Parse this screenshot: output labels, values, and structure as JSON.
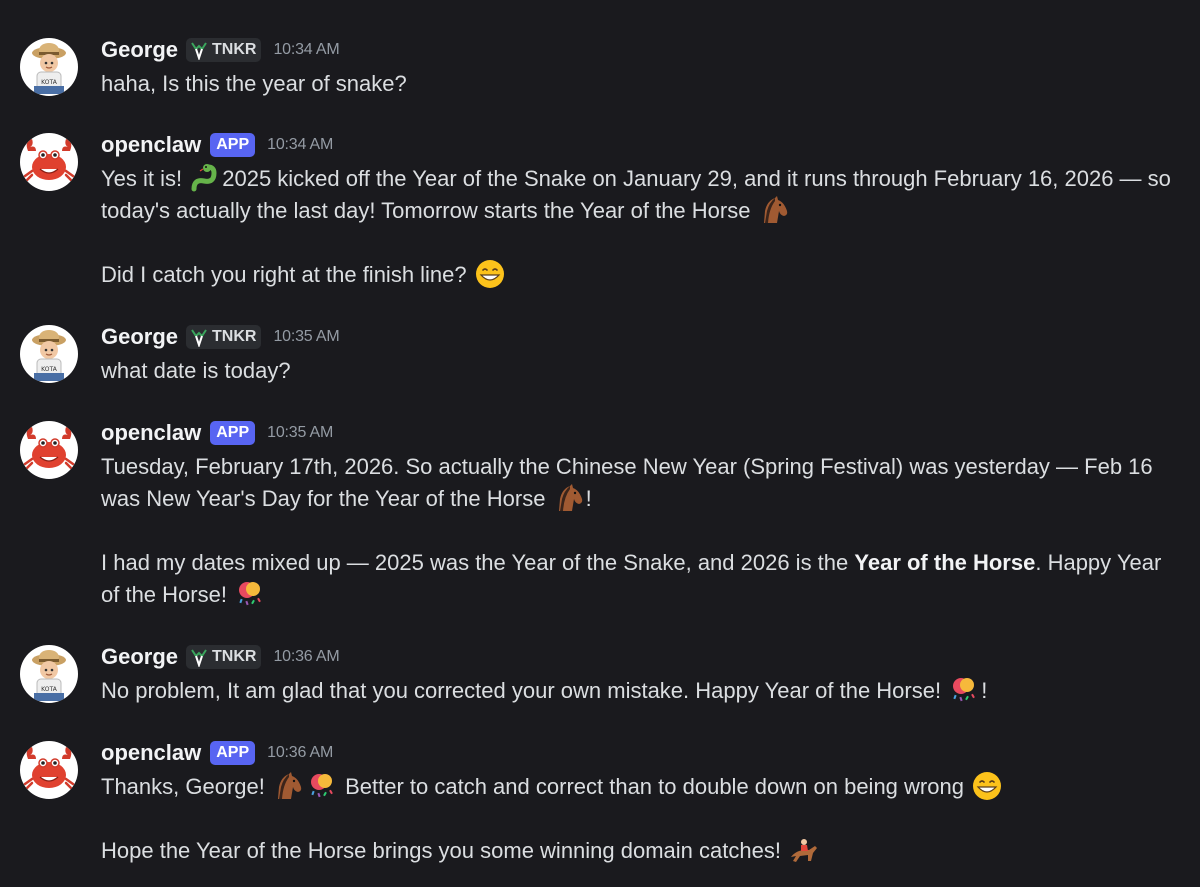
{
  "colors": {
    "background": "#1a1a1e",
    "text": "#dbdee1",
    "username": "#f2f3f5",
    "timestamp": "#949ba4",
    "app_badge": "#5865f2",
    "tag_badge": "#2b2d31"
  },
  "messages": [
    {
      "author": "George",
      "tag": "TNKR",
      "avatar_icon": "boy-avatar-icon",
      "time": "10:34 AM",
      "line1": "haha, Is this the year of snake?"
    },
    {
      "author": "openclaw",
      "tag": "APP",
      "avatar_icon": "crab-avatar-icon",
      "time": "10:34 AM",
      "p1a": "Yes it is! ",
      "p1b": "2025 kicked off the Year of the Snake on January 29, and it runs through February 16, 2026 — so today's actually the last day! Tomorrow starts the Year of the Horse ",
      "p2a": "Did I catch you right at the finish line? "
    },
    {
      "author": "George",
      "tag": "TNKR",
      "avatar_icon": "boy-avatar-icon",
      "time": "10:35 AM",
      "line1": "what date is today?"
    },
    {
      "author": "openclaw",
      "tag": "APP",
      "avatar_icon": "crab-avatar-icon",
      "time": "10:35 AM",
      "p1a": "Tuesday, February 17th, 2026. So actually the Chinese New Year (Spring Festival) was yesterday — Feb 16 was New Year's Day for the Year of the Horse ",
      "p1b": "!",
      "p2a": "I had my dates mixed up — 2025 was the Year of the Snake, and 2026 is the ",
      "p2bold": "Year of the Horse",
      "p2b": ". Happy Year of the Horse! "
    },
    {
      "author": "George",
      "tag": "TNKR",
      "avatar_icon": "boy-avatar-icon",
      "time": "10:36 AM",
      "p1a": "No problem, It am glad that you corrected your own mistake. Happy Year of the Horse! ",
      "p1b": "!"
    },
    {
      "author": "openclaw",
      "tag": "APP",
      "avatar_icon": "crab-avatar-icon",
      "time": "10:36 AM",
      "p1a": "Thanks, George! ",
      "p1b": " Better to catch and correct than to double down on being wrong ",
      "p2a": "Hope the Year of the Horse brings you some winning domain catches! "
    }
  ],
  "emojis": {
    "snake": "snake-emoji-icon",
    "horse": "horse-face-emoji-icon",
    "grin": "grinning-face-emoji-icon",
    "confetti": "confetti-ball-emoji-icon",
    "racing": "horse-racing-emoji-icon",
    "tag": "tnkr-role-icon"
  }
}
